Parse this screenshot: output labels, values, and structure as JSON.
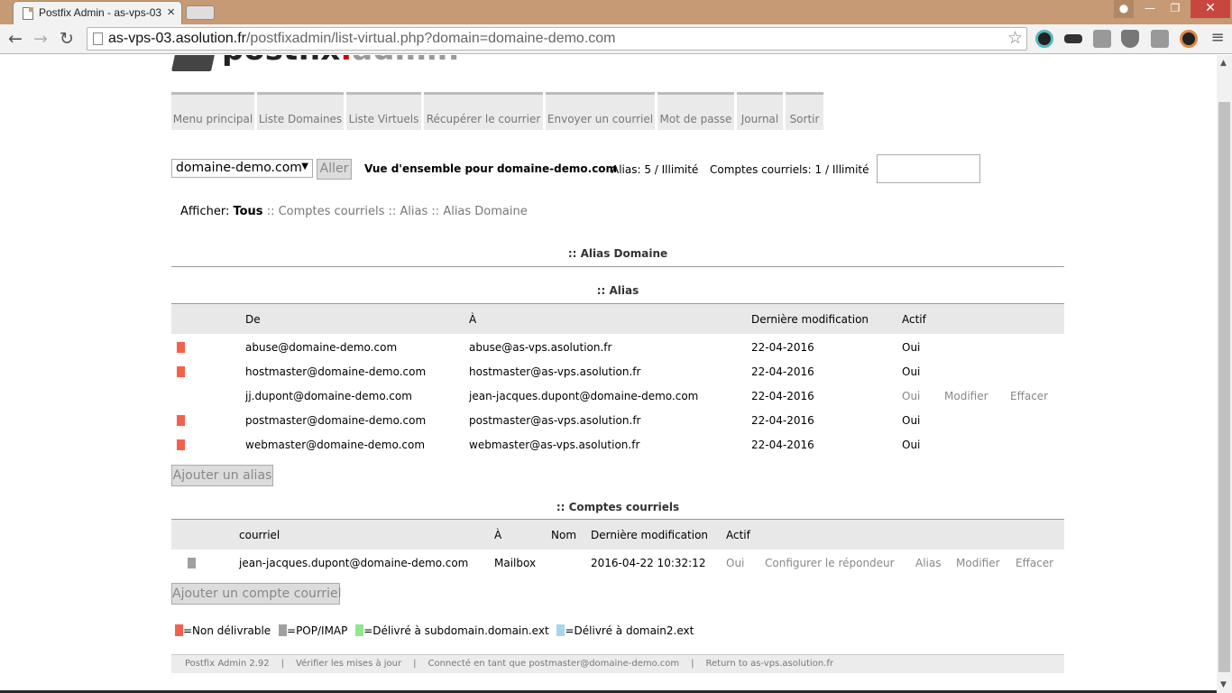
{
  "browser": {
    "tab_title": "Postfix Admin - as-vps-03",
    "url_host": "as-vps-03.asolution.fr",
    "url_path": "/postfixadmin/list-virtual.php?domain=domaine-demo.com"
  },
  "logo": {
    "part1": "postfix",
    "dot": ".",
    "part2": "admin"
  },
  "menu": [
    "Menu principal",
    "Liste Domaines",
    "Liste Virtuels",
    "Récupérer le courrier",
    "Envoyer un courriel",
    "Mot de passe",
    "Journal",
    "Sortir"
  ],
  "domain_selector": {
    "value": "domaine-demo.com",
    "go_label": "Aller"
  },
  "overview": {
    "title": "Vue d'ensemble pour domaine-demo.com",
    "alias_count": "Alias: 5 / Illimité",
    "mailbox_count": "Comptes courriels: 1 / Illimité"
  },
  "filter": {
    "label": "Afficher:",
    "all": "Tous",
    "sep": "::",
    "mailboxes": "Comptes courriels",
    "aliases": "Alias",
    "alias_domain": "Alias Domaine"
  },
  "alias_domain_section": {
    "title": ":: Alias Domaine"
  },
  "alias_section": {
    "title": ":: Alias",
    "headers": {
      "from": "De",
      "to": "À",
      "modified": "Dernière modification",
      "active": "Actif"
    },
    "rows": [
      {
        "marker": "#f4614b",
        "from": "abuse@domaine-demo.com",
        "to": "abuse@as-vps.asolution.fr",
        "modified": "22-04-2016",
        "active": "Oui",
        "edit": "",
        "delete": ""
      },
      {
        "marker": "#f4614b",
        "from": "hostmaster@domaine-demo.com",
        "to": "hostmaster@as-vps.asolution.fr",
        "modified": "22-04-2016",
        "active": "Oui",
        "edit": "",
        "delete": ""
      },
      {
        "marker": "",
        "from": "jj.dupont@domaine-demo.com",
        "to": "jean-jacques.dupont@domaine-demo.com",
        "modified": "22-04-2016",
        "active": "Oui",
        "edit": "Modifier",
        "delete": "Effacer"
      },
      {
        "marker": "#f4614b",
        "from": "postmaster@domaine-demo.com",
        "to": "postmaster@as-vps.asolution.fr",
        "modified": "22-04-2016",
        "active": "Oui",
        "edit": "",
        "delete": ""
      },
      {
        "marker": "#f4614b",
        "from": "webmaster@domaine-demo.com",
        "to": "webmaster@as-vps.asolution.fr",
        "modified": "22-04-2016",
        "active": "Oui",
        "edit": "",
        "delete": ""
      }
    ],
    "add_label": "Ajouter un alias"
  },
  "mailbox_section": {
    "title": ":: Comptes courriels",
    "headers": {
      "email": "courriel",
      "to": "À",
      "name": "Nom",
      "modified": "Dernière modification",
      "active": "Actif"
    },
    "rows": [
      {
        "marker": "#a0a0a0",
        "email": "jean-jacques.dupont@domaine-demo.com",
        "to": "Mailbox",
        "name": "",
        "modified": "2016-04-22 10:32:12",
        "active": "Oui",
        "vacation": "Configurer le répondeur",
        "alias": "Alias",
        "edit": "Modifier",
        "delete": "Effacer"
      }
    ],
    "add_label": "Ajouter un compte courriel"
  },
  "legend": [
    {
      "color": "#f4614b",
      "label": "=Non délivrable"
    },
    {
      "color": "#a0a0a0",
      "label": "=POP/IMAP"
    },
    {
      "color": "#8ee88e",
      "label": "=Délivré à subdomain.domain.ext"
    },
    {
      "color": "#a9d5ea",
      "label": "=Délivré à domain2.ext"
    }
  ],
  "footer": {
    "version": "Postfix Admin 2.92",
    "sep": "|",
    "check_updates": "Vérifier les mises à jour",
    "logged_in": "Connecté en tant que postmaster@domaine-demo.com",
    "return_to": "Return to as-vps.asolution.fr"
  }
}
